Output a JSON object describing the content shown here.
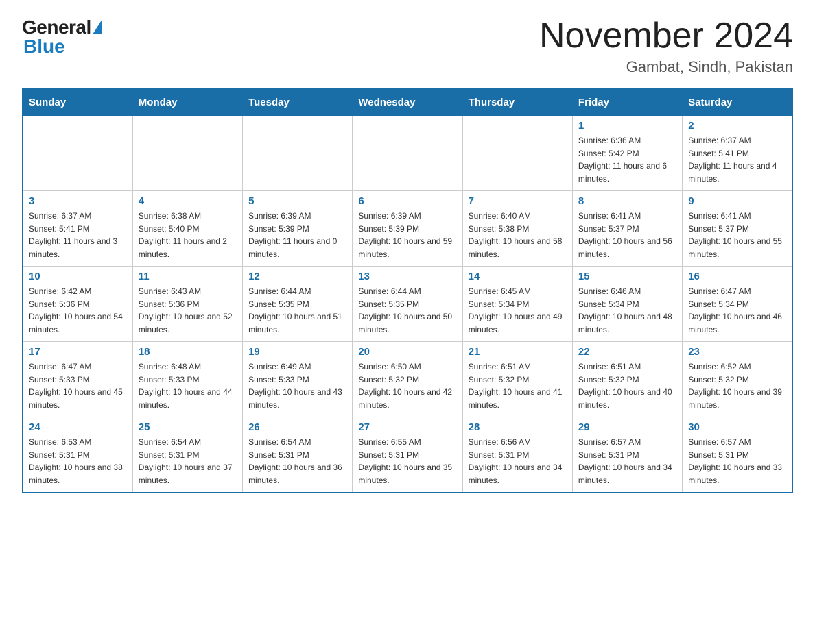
{
  "header": {
    "logo_general": "General",
    "logo_blue": "Blue",
    "month_title": "November 2024",
    "location": "Gambat, Sindh, Pakistan"
  },
  "days_of_week": [
    "Sunday",
    "Monday",
    "Tuesday",
    "Wednesday",
    "Thursday",
    "Friday",
    "Saturday"
  ],
  "weeks": [
    [
      {
        "day": "",
        "info": ""
      },
      {
        "day": "",
        "info": ""
      },
      {
        "day": "",
        "info": ""
      },
      {
        "day": "",
        "info": ""
      },
      {
        "day": "",
        "info": ""
      },
      {
        "day": "1",
        "info": "Sunrise: 6:36 AM\nSunset: 5:42 PM\nDaylight: 11 hours and 6 minutes."
      },
      {
        "day": "2",
        "info": "Sunrise: 6:37 AM\nSunset: 5:41 PM\nDaylight: 11 hours and 4 minutes."
      }
    ],
    [
      {
        "day": "3",
        "info": "Sunrise: 6:37 AM\nSunset: 5:41 PM\nDaylight: 11 hours and 3 minutes."
      },
      {
        "day": "4",
        "info": "Sunrise: 6:38 AM\nSunset: 5:40 PM\nDaylight: 11 hours and 2 minutes."
      },
      {
        "day": "5",
        "info": "Sunrise: 6:39 AM\nSunset: 5:39 PM\nDaylight: 11 hours and 0 minutes."
      },
      {
        "day": "6",
        "info": "Sunrise: 6:39 AM\nSunset: 5:39 PM\nDaylight: 10 hours and 59 minutes."
      },
      {
        "day": "7",
        "info": "Sunrise: 6:40 AM\nSunset: 5:38 PM\nDaylight: 10 hours and 58 minutes."
      },
      {
        "day": "8",
        "info": "Sunrise: 6:41 AM\nSunset: 5:37 PM\nDaylight: 10 hours and 56 minutes."
      },
      {
        "day": "9",
        "info": "Sunrise: 6:41 AM\nSunset: 5:37 PM\nDaylight: 10 hours and 55 minutes."
      }
    ],
    [
      {
        "day": "10",
        "info": "Sunrise: 6:42 AM\nSunset: 5:36 PM\nDaylight: 10 hours and 54 minutes."
      },
      {
        "day": "11",
        "info": "Sunrise: 6:43 AM\nSunset: 5:36 PM\nDaylight: 10 hours and 52 minutes."
      },
      {
        "day": "12",
        "info": "Sunrise: 6:44 AM\nSunset: 5:35 PM\nDaylight: 10 hours and 51 minutes."
      },
      {
        "day": "13",
        "info": "Sunrise: 6:44 AM\nSunset: 5:35 PM\nDaylight: 10 hours and 50 minutes."
      },
      {
        "day": "14",
        "info": "Sunrise: 6:45 AM\nSunset: 5:34 PM\nDaylight: 10 hours and 49 minutes."
      },
      {
        "day": "15",
        "info": "Sunrise: 6:46 AM\nSunset: 5:34 PM\nDaylight: 10 hours and 48 minutes."
      },
      {
        "day": "16",
        "info": "Sunrise: 6:47 AM\nSunset: 5:34 PM\nDaylight: 10 hours and 46 minutes."
      }
    ],
    [
      {
        "day": "17",
        "info": "Sunrise: 6:47 AM\nSunset: 5:33 PM\nDaylight: 10 hours and 45 minutes."
      },
      {
        "day": "18",
        "info": "Sunrise: 6:48 AM\nSunset: 5:33 PM\nDaylight: 10 hours and 44 minutes."
      },
      {
        "day": "19",
        "info": "Sunrise: 6:49 AM\nSunset: 5:33 PM\nDaylight: 10 hours and 43 minutes."
      },
      {
        "day": "20",
        "info": "Sunrise: 6:50 AM\nSunset: 5:32 PM\nDaylight: 10 hours and 42 minutes."
      },
      {
        "day": "21",
        "info": "Sunrise: 6:51 AM\nSunset: 5:32 PM\nDaylight: 10 hours and 41 minutes."
      },
      {
        "day": "22",
        "info": "Sunrise: 6:51 AM\nSunset: 5:32 PM\nDaylight: 10 hours and 40 minutes."
      },
      {
        "day": "23",
        "info": "Sunrise: 6:52 AM\nSunset: 5:32 PM\nDaylight: 10 hours and 39 minutes."
      }
    ],
    [
      {
        "day": "24",
        "info": "Sunrise: 6:53 AM\nSunset: 5:31 PM\nDaylight: 10 hours and 38 minutes."
      },
      {
        "day": "25",
        "info": "Sunrise: 6:54 AM\nSunset: 5:31 PM\nDaylight: 10 hours and 37 minutes."
      },
      {
        "day": "26",
        "info": "Sunrise: 6:54 AM\nSunset: 5:31 PM\nDaylight: 10 hours and 36 minutes."
      },
      {
        "day": "27",
        "info": "Sunrise: 6:55 AM\nSunset: 5:31 PM\nDaylight: 10 hours and 35 minutes."
      },
      {
        "day": "28",
        "info": "Sunrise: 6:56 AM\nSunset: 5:31 PM\nDaylight: 10 hours and 34 minutes."
      },
      {
        "day": "29",
        "info": "Sunrise: 6:57 AM\nSunset: 5:31 PM\nDaylight: 10 hours and 34 minutes."
      },
      {
        "day": "30",
        "info": "Sunrise: 6:57 AM\nSunset: 5:31 PM\nDaylight: 10 hours and 33 minutes."
      }
    ]
  ]
}
